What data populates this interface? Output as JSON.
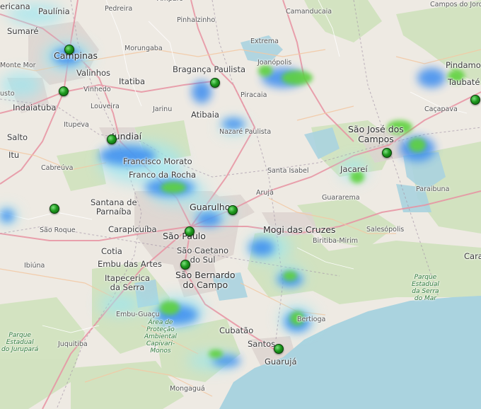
{
  "map": {
    "cities": [
      {
        "name": "ericana",
        "cls": "med"
      },
      {
        "name": "Paulínia",
        "cls": "med"
      },
      {
        "name": "Pedreira",
        "cls": "small"
      },
      {
        "name": "Amparo",
        "cls": "small"
      },
      {
        "name": "Camanducaia",
        "cls": "small"
      },
      {
        "name": "Campos do Jordão",
        "cls": "small"
      },
      {
        "name": "Sumaré",
        "cls": "med"
      },
      {
        "name": "Pinhalzinho",
        "cls": "small"
      },
      {
        "name": "Campinas",
        "cls": "big"
      },
      {
        "name": "Morungaba",
        "cls": "small"
      },
      {
        "name": "Extrema",
        "cls": "small"
      },
      {
        "name": "Monte Mor",
        "cls": "small"
      },
      {
        "name": "Valinhos",
        "cls": "med"
      },
      {
        "name": "Bragança Paulista",
        "cls": "med"
      },
      {
        "name": "Joanópolis",
        "cls": "small"
      },
      {
        "name": "Pindamo",
        "cls": "med"
      },
      {
        "name": "Indaiatuba",
        "cls": "med"
      },
      {
        "name": "Itatiba",
        "cls": "med"
      },
      {
        "name": "Vinhedo",
        "cls": "small"
      },
      {
        "name": "Piracaia",
        "cls": "small"
      },
      {
        "name": "Taubaté",
        "cls": "med"
      },
      {
        "name": "usto",
        "cls": "small"
      },
      {
        "name": "Louveira",
        "cls": "small"
      },
      {
        "name": "Jarinu",
        "cls": "small"
      },
      {
        "name": "Atibaia",
        "cls": "med"
      },
      {
        "name": "Caçapava",
        "cls": "small"
      },
      {
        "name": "Itupeva",
        "cls": "small"
      },
      {
        "name": "Nazaré Paulista",
        "cls": "small"
      },
      {
        "name": "São José dos Campos",
        "cls": "big"
      },
      {
        "name": "Salto",
        "cls": "med"
      },
      {
        "name": "Jundiaí",
        "cls": "big"
      },
      {
        "name": "Itu",
        "cls": "med"
      },
      {
        "name": "Francisco Morato",
        "cls": "med"
      },
      {
        "name": "Cabreúva",
        "cls": "small"
      },
      {
        "name": "Franco da Rocha",
        "cls": "med"
      },
      {
        "name": "Santa Isabel",
        "cls": "small"
      },
      {
        "name": "Jacareí",
        "cls": "med"
      },
      {
        "name": "Arujá",
        "cls": "small"
      },
      {
        "name": "Paraibuna",
        "cls": "small"
      },
      {
        "name": "Guarulhos",
        "cls": "big"
      },
      {
        "name": "Guararema",
        "cls": "small"
      },
      {
        "name": "Santana de Parnaíba",
        "cls": "med"
      },
      {
        "name": "São Roque",
        "cls": "small"
      },
      {
        "name": "Carapicuíba",
        "cls": "med"
      },
      {
        "name": "Mogi das Cruzes",
        "cls": "big"
      },
      {
        "name": "Salesópolis",
        "cls": "small"
      },
      {
        "name": "São Paulo",
        "cls": "big"
      },
      {
        "name": "Biritiba-Mirim",
        "cls": "small"
      },
      {
        "name": "Cotia",
        "cls": "med"
      },
      {
        "name": "São Caetano do Sul",
        "cls": "med"
      },
      {
        "name": "Embu das Artes",
        "cls": "med"
      },
      {
        "name": "Ibiúna",
        "cls": "small"
      },
      {
        "name": "São Bernardo do Campo",
        "cls": "big"
      },
      {
        "name": "Itapecerica da Serra",
        "cls": "med"
      },
      {
        "name": "Cara",
        "cls": "med"
      },
      {
        "name": "Embu-Guaçu",
        "cls": "small"
      },
      {
        "name": "Bertioga",
        "cls": "small"
      },
      {
        "name": "Cubatão",
        "cls": "med"
      },
      {
        "name": "Juquitiba",
        "cls": "small"
      },
      {
        "name": "Santos",
        "cls": "med"
      },
      {
        "name": "Guarujá",
        "cls": "med"
      },
      {
        "name": "Mongaguá",
        "cls": "small"
      }
    ],
    "parks": [
      {
        "name": "Parque Estadual da Serra do Mar"
      },
      {
        "name": "Área de Proteção Ambiental Capivari-Monos"
      },
      {
        "name": "Parque Estadual do Jurupará"
      }
    ],
    "markers": [
      "Campinas",
      "Indaiatuba",
      "Bragança Paulista",
      "Taubaté",
      "Jundiaí",
      "São José dos Campos",
      "Guarulhos",
      "Santana de Parnaíba",
      "São Paulo",
      "São Bernardo do Campo",
      "Santos"
    ],
    "colors": {
      "background": "#eeeae3",
      "ocean": "#aad3df",
      "forest": "#c8dcb4",
      "urban": "#ddd4d0",
      "road_major": "#e892a2",
      "radar_light": "#9ee6f0",
      "radar_medium": "#3a8cf0",
      "radar_strong": "#5fd23c",
      "marker": "#1e9a1e"
    }
  }
}
